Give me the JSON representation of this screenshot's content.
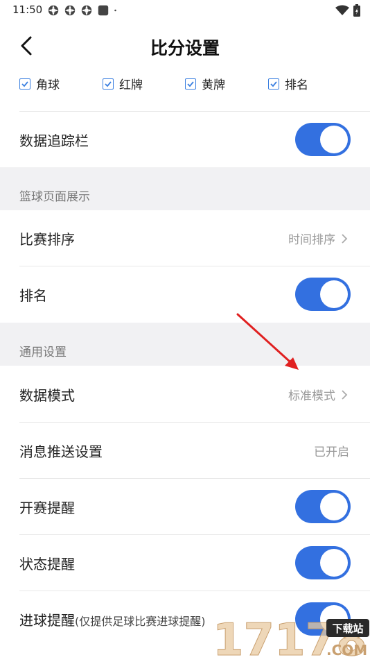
{
  "status_bar": {
    "time": "11:50",
    "icons": [
      "app-notification-icon",
      "app-notification-icon",
      "app-notification-icon",
      "square-notification-icon",
      "dot-icon",
      "wifi-icon",
      "battery-icon"
    ]
  },
  "header": {
    "title": "比分设置"
  },
  "checkboxes": [
    {
      "label": "角球",
      "checked": true
    },
    {
      "label": "红牌",
      "checked": true
    },
    {
      "label": "黄牌",
      "checked": true
    },
    {
      "label": "排名",
      "checked": true
    }
  ],
  "rows": {
    "data_tracker": {
      "label": "数据追踪栏",
      "on": true
    },
    "basketball_section": "篮球页面展示",
    "match_sort": {
      "label": "比赛排序",
      "value": "时间排序"
    },
    "ranking": {
      "label": "排名",
      "on": true
    },
    "general_section": "通用设置",
    "data_mode": {
      "label": "数据模式",
      "value": "标准模式"
    },
    "push_settings": {
      "label": "消息推送设置",
      "value": "已开启"
    },
    "start_reminder": {
      "label": "开赛提醒",
      "on": true
    },
    "status_reminder": {
      "label": "状态提醒",
      "on": true
    },
    "goal_reminder": {
      "label": "进球提醒",
      "note": "(仅提供足球比赛进球提醒)",
      "on": true
    }
  },
  "watermark": {
    "number": "17178",
    "domain": ".COM",
    "badge": "下载站"
  },
  "colors": {
    "accent": "#3370e0",
    "checkbox": "#3a7fe0",
    "section_bg": "#f1f1f3",
    "annotation_arrow": "#e02020"
  }
}
